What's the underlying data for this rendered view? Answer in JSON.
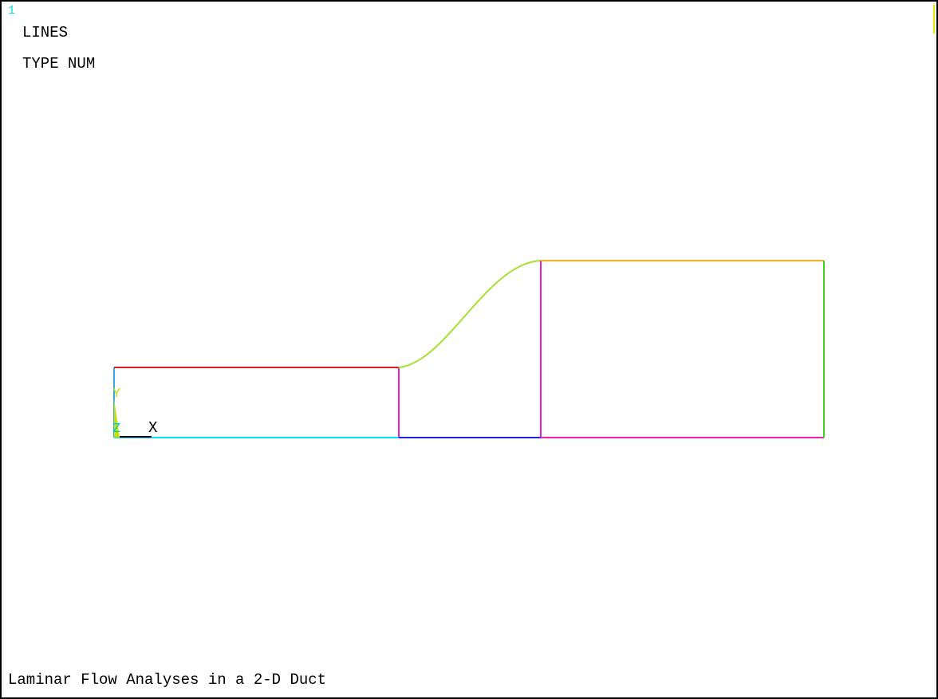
{
  "window_number": "1",
  "plot": {
    "title": "LINES",
    "subtitle": "TYPE NUM",
    "footer": "Laminar Flow Analyses in a 2-D Duct"
  },
  "triad": {
    "y_label": "Y",
    "z_label": "Z",
    "x_label": "X"
  },
  "colors": {
    "window_number": "#00e0e0",
    "left_edge": "#3aa8e8",
    "bottom_inlet": "#00e0ff",
    "top_inlet": "#e02020",
    "mid_vertical_1": "#e020e0",
    "bottom_middle": "#2020e0",
    "transition_curve": "#a8e030",
    "mid_vertical_2": "#e020e0",
    "top_outlet": "#f0b020",
    "bottom_outlet": "#f020b0",
    "right_edge": "#40d020",
    "triad_y": "#c8e000",
    "triad_z": "#00c8c8",
    "triad_x": "#000000"
  }
}
